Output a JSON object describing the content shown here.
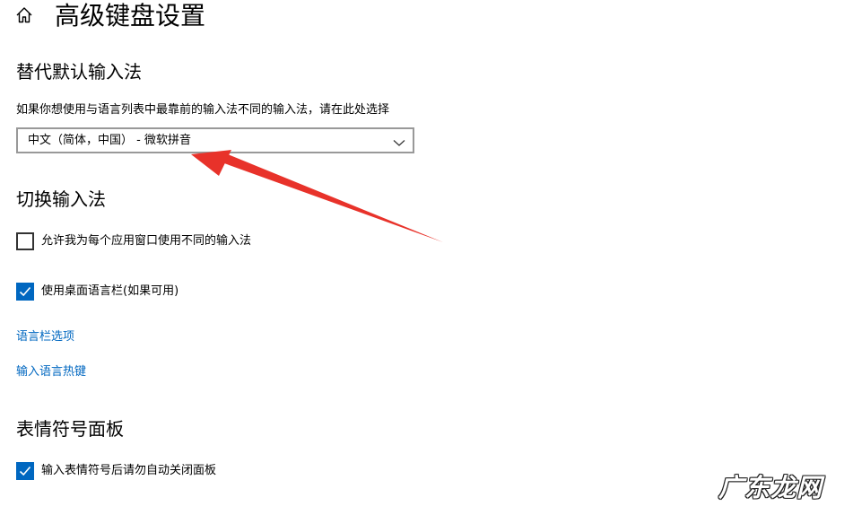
{
  "header": {
    "title": "高级键盘设置",
    "home_icon": "home-icon"
  },
  "override_input": {
    "section_title": "替代默认输入法",
    "description": "如果你想使用与语言列表中最靠前的输入法不同的输入法，请在此处选择",
    "dropdown_value": "中文（简体，中国） - 微软拼音"
  },
  "switching": {
    "section_title": "切换输入法",
    "options": [
      {
        "label": "允许我为每个应用窗口使用不同的输入法",
        "checked": false
      },
      {
        "label": "使用桌面语言栏(如果可用)",
        "checked": true
      }
    ],
    "links": [
      "语言栏选项",
      "输入语言热键"
    ]
  },
  "emoji_panel": {
    "section_title": "表情符号面板",
    "options": [
      {
        "label": "输入表情符号后请勿自动关闭面板",
        "checked": true
      }
    ]
  },
  "annotation": {
    "arrow_color": "#e8322a"
  },
  "watermark": {
    "text": "广东龙网"
  },
  "colors": {
    "accent": "#0067c0",
    "link": "#0067c0"
  }
}
